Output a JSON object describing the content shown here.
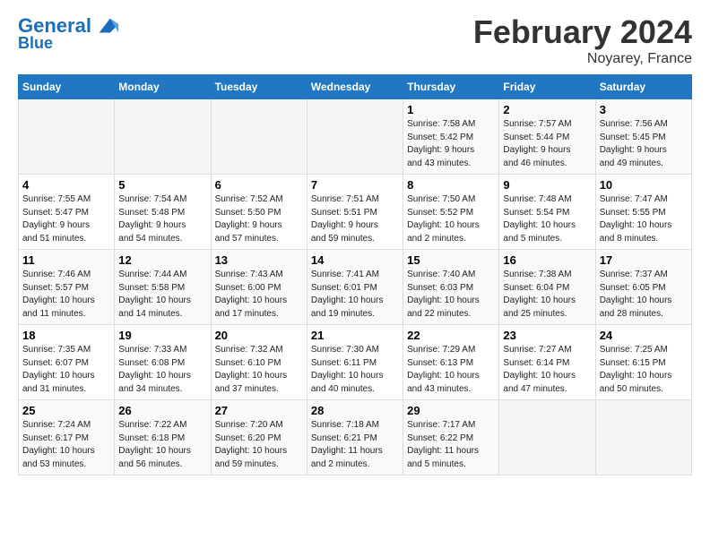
{
  "header": {
    "logo_line1": "General",
    "logo_line2": "Blue",
    "title": "February 2024",
    "subtitle": "Noyarey, France"
  },
  "days_of_week": [
    "Sunday",
    "Monday",
    "Tuesday",
    "Wednesday",
    "Thursday",
    "Friday",
    "Saturday"
  ],
  "weeks": [
    [
      {
        "num": "",
        "info": ""
      },
      {
        "num": "",
        "info": ""
      },
      {
        "num": "",
        "info": ""
      },
      {
        "num": "",
        "info": ""
      },
      {
        "num": "1",
        "info": "Sunrise: 7:58 AM\nSunset: 5:42 PM\nDaylight: 9 hours\nand 43 minutes."
      },
      {
        "num": "2",
        "info": "Sunrise: 7:57 AM\nSunset: 5:44 PM\nDaylight: 9 hours\nand 46 minutes."
      },
      {
        "num": "3",
        "info": "Sunrise: 7:56 AM\nSunset: 5:45 PM\nDaylight: 9 hours\nand 49 minutes."
      }
    ],
    [
      {
        "num": "4",
        "info": "Sunrise: 7:55 AM\nSunset: 5:47 PM\nDaylight: 9 hours\nand 51 minutes."
      },
      {
        "num": "5",
        "info": "Sunrise: 7:54 AM\nSunset: 5:48 PM\nDaylight: 9 hours\nand 54 minutes."
      },
      {
        "num": "6",
        "info": "Sunrise: 7:52 AM\nSunset: 5:50 PM\nDaylight: 9 hours\nand 57 minutes."
      },
      {
        "num": "7",
        "info": "Sunrise: 7:51 AM\nSunset: 5:51 PM\nDaylight: 9 hours\nand 59 minutes."
      },
      {
        "num": "8",
        "info": "Sunrise: 7:50 AM\nSunset: 5:52 PM\nDaylight: 10 hours\nand 2 minutes."
      },
      {
        "num": "9",
        "info": "Sunrise: 7:48 AM\nSunset: 5:54 PM\nDaylight: 10 hours\nand 5 minutes."
      },
      {
        "num": "10",
        "info": "Sunrise: 7:47 AM\nSunset: 5:55 PM\nDaylight: 10 hours\nand 8 minutes."
      }
    ],
    [
      {
        "num": "11",
        "info": "Sunrise: 7:46 AM\nSunset: 5:57 PM\nDaylight: 10 hours\nand 11 minutes."
      },
      {
        "num": "12",
        "info": "Sunrise: 7:44 AM\nSunset: 5:58 PM\nDaylight: 10 hours\nand 14 minutes."
      },
      {
        "num": "13",
        "info": "Sunrise: 7:43 AM\nSunset: 6:00 PM\nDaylight: 10 hours\nand 17 minutes."
      },
      {
        "num": "14",
        "info": "Sunrise: 7:41 AM\nSunset: 6:01 PM\nDaylight: 10 hours\nand 19 minutes."
      },
      {
        "num": "15",
        "info": "Sunrise: 7:40 AM\nSunset: 6:03 PM\nDaylight: 10 hours\nand 22 minutes."
      },
      {
        "num": "16",
        "info": "Sunrise: 7:38 AM\nSunset: 6:04 PM\nDaylight: 10 hours\nand 25 minutes."
      },
      {
        "num": "17",
        "info": "Sunrise: 7:37 AM\nSunset: 6:05 PM\nDaylight: 10 hours\nand 28 minutes."
      }
    ],
    [
      {
        "num": "18",
        "info": "Sunrise: 7:35 AM\nSunset: 6:07 PM\nDaylight: 10 hours\nand 31 minutes."
      },
      {
        "num": "19",
        "info": "Sunrise: 7:33 AM\nSunset: 6:08 PM\nDaylight: 10 hours\nand 34 minutes."
      },
      {
        "num": "20",
        "info": "Sunrise: 7:32 AM\nSunset: 6:10 PM\nDaylight: 10 hours\nand 37 minutes."
      },
      {
        "num": "21",
        "info": "Sunrise: 7:30 AM\nSunset: 6:11 PM\nDaylight: 10 hours\nand 40 minutes."
      },
      {
        "num": "22",
        "info": "Sunrise: 7:29 AM\nSunset: 6:13 PM\nDaylight: 10 hours\nand 43 minutes."
      },
      {
        "num": "23",
        "info": "Sunrise: 7:27 AM\nSunset: 6:14 PM\nDaylight: 10 hours\nand 47 minutes."
      },
      {
        "num": "24",
        "info": "Sunrise: 7:25 AM\nSunset: 6:15 PM\nDaylight: 10 hours\nand 50 minutes."
      }
    ],
    [
      {
        "num": "25",
        "info": "Sunrise: 7:24 AM\nSunset: 6:17 PM\nDaylight: 10 hours\nand 53 minutes."
      },
      {
        "num": "26",
        "info": "Sunrise: 7:22 AM\nSunset: 6:18 PM\nDaylight: 10 hours\nand 56 minutes."
      },
      {
        "num": "27",
        "info": "Sunrise: 7:20 AM\nSunset: 6:20 PM\nDaylight: 10 hours\nand 59 minutes."
      },
      {
        "num": "28",
        "info": "Sunrise: 7:18 AM\nSunset: 6:21 PM\nDaylight: 11 hours\nand 2 minutes."
      },
      {
        "num": "29",
        "info": "Sunrise: 7:17 AM\nSunset: 6:22 PM\nDaylight: 11 hours\nand 5 minutes."
      },
      {
        "num": "",
        "info": ""
      },
      {
        "num": "",
        "info": ""
      }
    ]
  ]
}
